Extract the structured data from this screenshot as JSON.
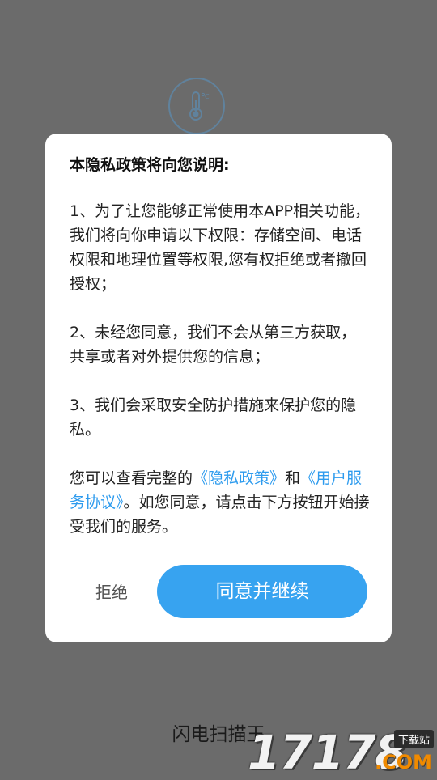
{
  "app": {
    "name": "闪电扫描王",
    "logo_icon": "thermometer-icon"
  },
  "dialog": {
    "title": "本隐私政策将向您说明:",
    "paragraph1": "1、为了让您能够正常使用本APP相关功能，我们将向你申请以下权限：存储空间、电话权限和地理位置等权限,您有权拒绝或者撤回授权；",
    "paragraph2": "2、未经您同意，我们不会从第三方获取，共享或者对外提供您的信息；",
    "paragraph3": "3、我们会采取安全防护措施来保护您的隐私。",
    "notice_prefix": "您可以查看完整的",
    "privacy_link": "《隐私政策》",
    "notice_and": "和",
    "service_link": "《用户服务协议》",
    "notice_suffix": "。如您同意，请点击下方按钮开始接受我们的服务。",
    "reject_label": "拒绝",
    "agree_label": "同意并继续"
  },
  "watermark": {
    "digits": "17178",
    "site_label": "下载站",
    "domain": ".COM"
  },
  "colors": {
    "overlay_background": "#6b6b6b",
    "accent": "#37a3f0",
    "link": "#2d9bee"
  }
}
